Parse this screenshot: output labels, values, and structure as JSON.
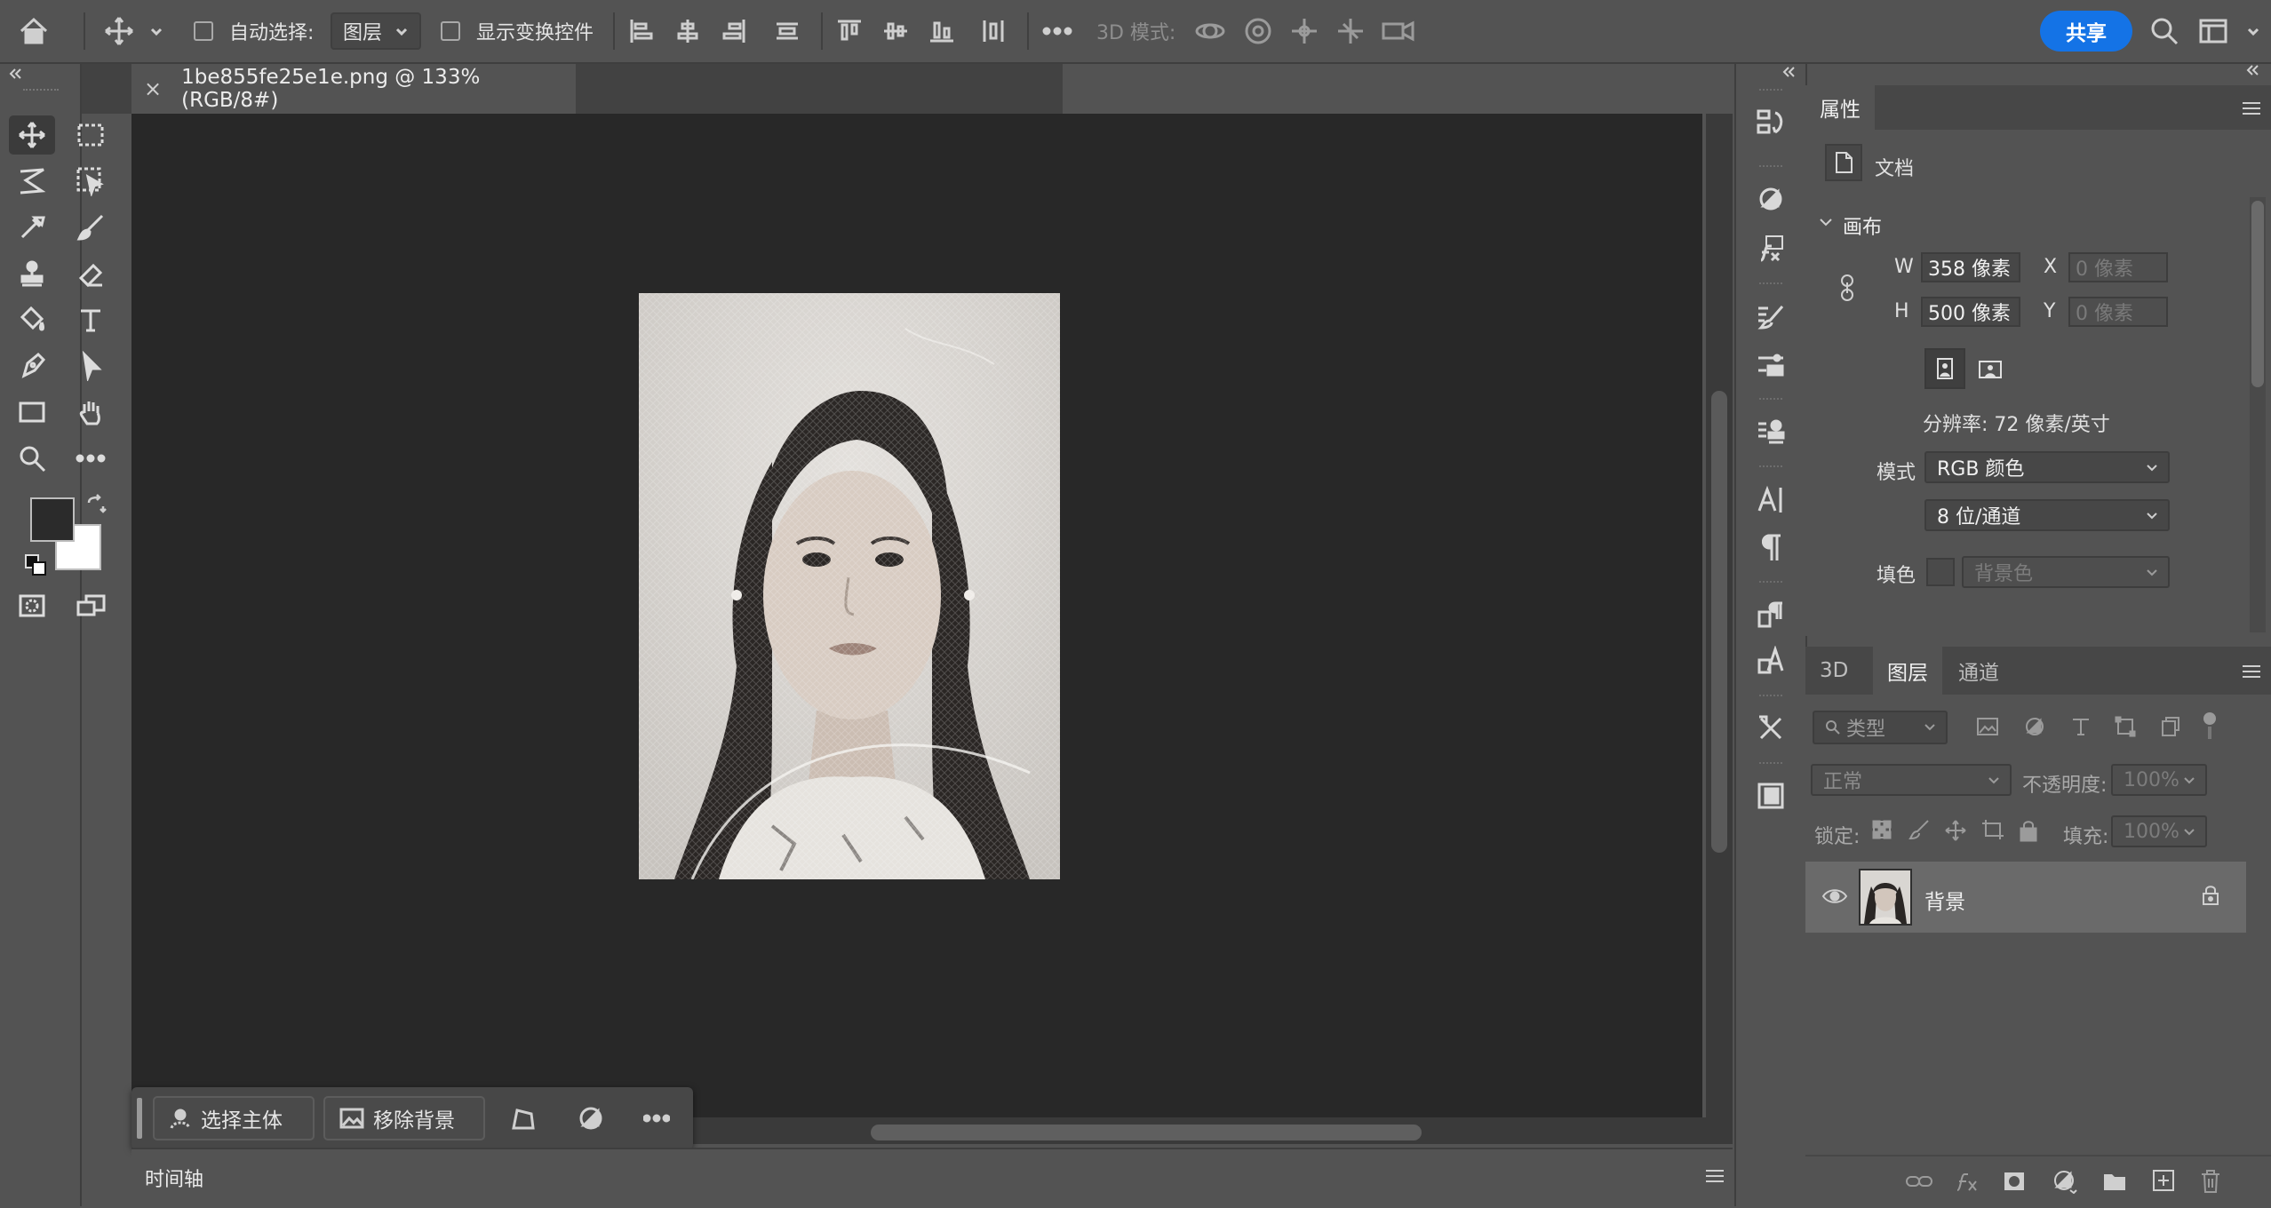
{
  "options_bar": {
    "auto_select_label": "自动选择:",
    "auto_select_target": "图层",
    "show_transform_label": "显示变换控件",
    "mode_3d_label": "3D 模式:",
    "share_label": "共享"
  },
  "document": {
    "tab_title": "1be855fe25e1e.png @ 133%(RGB/8#)",
    "close_glyph": "×"
  },
  "task_bar": {
    "select_subject": "选择主体",
    "remove_background": "移除背景"
  },
  "timeline": {
    "label": "时间轴"
  },
  "properties": {
    "tab_label": "属性",
    "doc_label": "文档",
    "canvas_section": "画布",
    "w_label": "W",
    "w_value": "358 像素",
    "h_label": "H",
    "h_value": "500 像素",
    "x_label": "X",
    "x_placeholder": "0 像素",
    "y_label": "Y",
    "y_placeholder": "0 像素",
    "resolution": "分辨率: 72 像素/英寸",
    "mode_label": "模式",
    "mode_value": "RGB 颜色",
    "bit_depth": "8 位/通道",
    "fill_label": "填色",
    "fill_value": "背景色"
  },
  "layers_panel": {
    "tabs": [
      "3D",
      "图层",
      "通道"
    ],
    "active_tab": "图层",
    "filter_label": "类型",
    "blend_mode": "正常",
    "opacity_label": "不透明度:",
    "opacity_value": "100%",
    "lock_label": "锁定:",
    "fill_label": "填充:",
    "fill_value": "100%",
    "layers": [
      {
        "name": "背景",
        "visible": true,
        "locked": true
      }
    ]
  },
  "colors": {
    "accent": "#1473e6",
    "ui_bg": "#535353",
    "canvas_bg": "#282828",
    "foreground_swatch": "#2b2b2b",
    "background_swatch": "#ffffff"
  }
}
